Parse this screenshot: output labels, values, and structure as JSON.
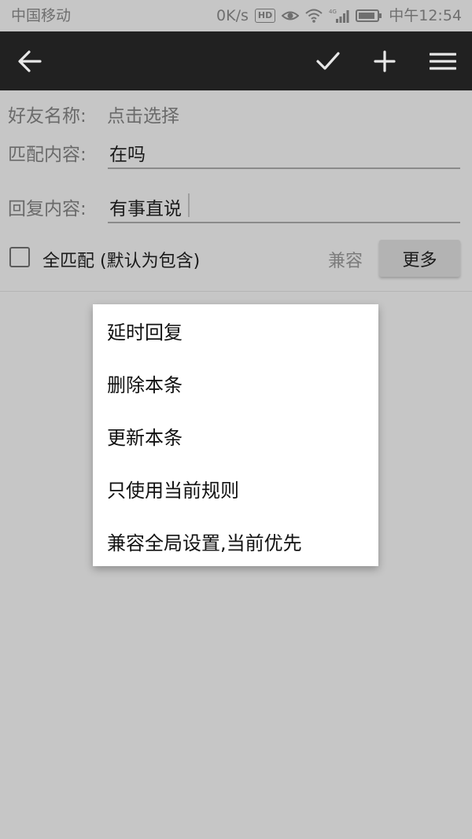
{
  "status_bar": {
    "carrier": "中国移动",
    "net_speed": "0K/s",
    "hd": "HD",
    "time": "中午12:54",
    "icons": [
      "hd-icon",
      "eye-icon",
      "wifi-icon",
      "signal-4g-icon",
      "battery-icon"
    ]
  },
  "toolbar": {
    "icons": [
      "back-arrow-icon",
      "check-icon",
      "plus-icon",
      "menu-icon"
    ]
  },
  "form": {
    "friend_label": "好友名称:",
    "friend_value": "点击选择",
    "match_label": "匹配内容:",
    "match_value": "在吗",
    "reply_label": "回复内容:",
    "reply_value": "有事直说",
    "full_match_label": "全匹配 (默认为包含)",
    "full_match_checked": false,
    "compat_label": "兼容",
    "more_label": "更多"
  },
  "menu": {
    "items": [
      "延时回复",
      "删除本条",
      "更新本条",
      "只使用当前规则",
      "兼容全局设置,当前优先"
    ]
  },
  "colors": {
    "toolbar_bg": "#212121",
    "dimmed_bg": "#c6c6c6",
    "menu_bg": "#ffffff"
  }
}
